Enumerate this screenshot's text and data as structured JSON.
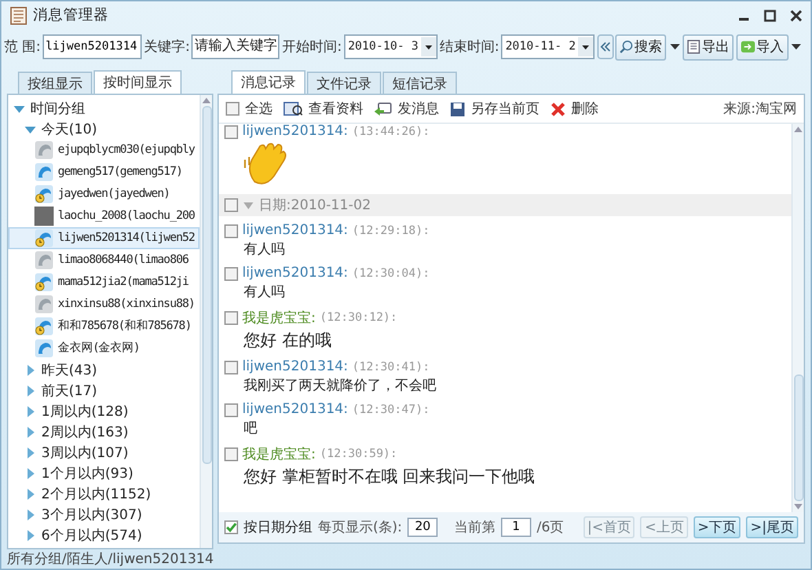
{
  "window": {
    "title": "消息管理器"
  },
  "filter": {
    "scope_label": "范 围:",
    "scope_value": "lijwen5201314",
    "keyword_label": "关键字:",
    "keyword_placeholder": "请输入关键字",
    "start_label": "开始时间:",
    "start_value": "2010-10- 3",
    "end_label": "结束时间:",
    "end_value": "2010-11- 2",
    "search": "搜索",
    "export": "导出",
    "import": "导入"
  },
  "left_tabs": [
    {
      "label": "按组显示",
      "selected": false
    },
    {
      "label": "按时间显示",
      "selected": true
    }
  ],
  "tree": [
    {
      "label": "时间分组",
      "expanded": true,
      "children": [
        {
          "label": "今天(10)",
          "expanded": true,
          "children": [
            {
              "label": "ejupqblycm030(ejupqbly",
              "kind": "offline",
              "selected": false
            },
            {
              "label": "gemeng517(gemeng517)",
              "kind": "online",
              "selected": false
            },
            {
              "label": "jayedwen(jayedwen)",
              "kind": "away",
              "selected": false
            },
            {
              "label": "laochu_2008(laochu_200",
              "kind": "photo",
              "selected": false
            },
            {
              "label": "lijwen5201314(lijwen52",
              "kind": "away",
              "selected": true
            },
            {
              "label": "limao8068440(limao806",
              "kind": "offline",
              "selected": false
            },
            {
              "label": "mama512jia2(mama512ji",
              "kind": "away",
              "selected": false
            },
            {
              "label": "xinxinsu88(xinxinsu88)",
              "kind": "offline",
              "selected": false
            },
            {
              "label": "和和785678(和和785678)",
              "kind": "away",
              "selected": false
            },
            {
              "label": "金衣网(金衣网)",
              "kind": "online",
              "selected": false
            }
          ]
        },
        {
          "label": "昨天(43)",
          "expanded": false
        },
        {
          "label": "前天(17)",
          "expanded": false
        },
        {
          "label": "1周以内(128)",
          "expanded": false
        },
        {
          "label": "2周以内(163)",
          "expanded": false
        },
        {
          "label": "3周以内(107)",
          "expanded": false
        },
        {
          "label": "1个月以内(93)",
          "expanded": false
        },
        {
          "label": "2个月以内(1152)",
          "expanded": false
        },
        {
          "label": "3个月以内(307)",
          "expanded": false
        },
        {
          "label": "6个月以内(574)",
          "expanded": false
        }
      ]
    }
  ],
  "status_bar": "所有分组/陌生人/lijwen5201314",
  "right_tabs": [
    {
      "label": "消息记录",
      "selected": true
    },
    {
      "label": "文件记录",
      "selected": false
    },
    {
      "label": "短信记录",
      "selected": false
    }
  ],
  "toolbar": {
    "select_all": "全选",
    "select_all_checked": false,
    "profile": "查看资料",
    "send": "发消息",
    "save": "另存当前页",
    "delete": "删除",
    "source": "来源:淘宝网"
  },
  "messages": [
    {
      "kind": "other",
      "sender": "lijwen5201314:",
      "time": "(13:44:26):",
      "sticker": true,
      "checked": false
    },
    {
      "kind": "date",
      "text": "日期:2010-11-02",
      "checked": false
    },
    {
      "kind": "other",
      "sender": "lijwen5201314:",
      "time": "(12:29:18):",
      "text": "有人吗",
      "checked": false
    },
    {
      "kind": "other",
      "sender": "lijwen5201314:",
      "time": "(12:30:04):",
      "text": "有人吗",
      "checked": false
    },
    {
      "kind": "self",
      "sender": "我是虎宝宝:",
      "time": "(12:30:12):",
      "text": "您好  在的哦",
      "checked": false
    },
    {
      "kind": "other",
      "sender": "lijwen5201314:",
      "time": "(12:30:41):",
      "text": "我刚买了两天就降价了，不会吧",
      "checked": false
    },
    {
      "kind": "other",
      "sender": "lijwen5201314:",
      "time": "(12:30:47):",
      "text": "吧",
      "checked": false
    },
    {
      "kind": "self",
      "sender": "我是虎宝宝:",
      "time": "(12:30:59):",
      "text": "您好  掌柜暂时不在哦  回来我问一下他哦",
      "checked": false
    }
  ],
  "footer": {
    "group_by_date": "按日期分组",
    "group_by_date_checked": true,
    "per_page_label": "每页显示(条):",
    "per_page": "20",
    "page_label": "当前第",
    "page": "1",
    "page_total": "/6页",
    "pager": [
      {
        "label": "|<首页",
        "disabled": true
      },
      {
        "label": "<上页",
        "disabled": true
      },
      {
        "label": ">下页",
        "disabled": false
      },
      {
        "label": ">|尾页",
        "disabled": false
      }
    ]
  }
}
